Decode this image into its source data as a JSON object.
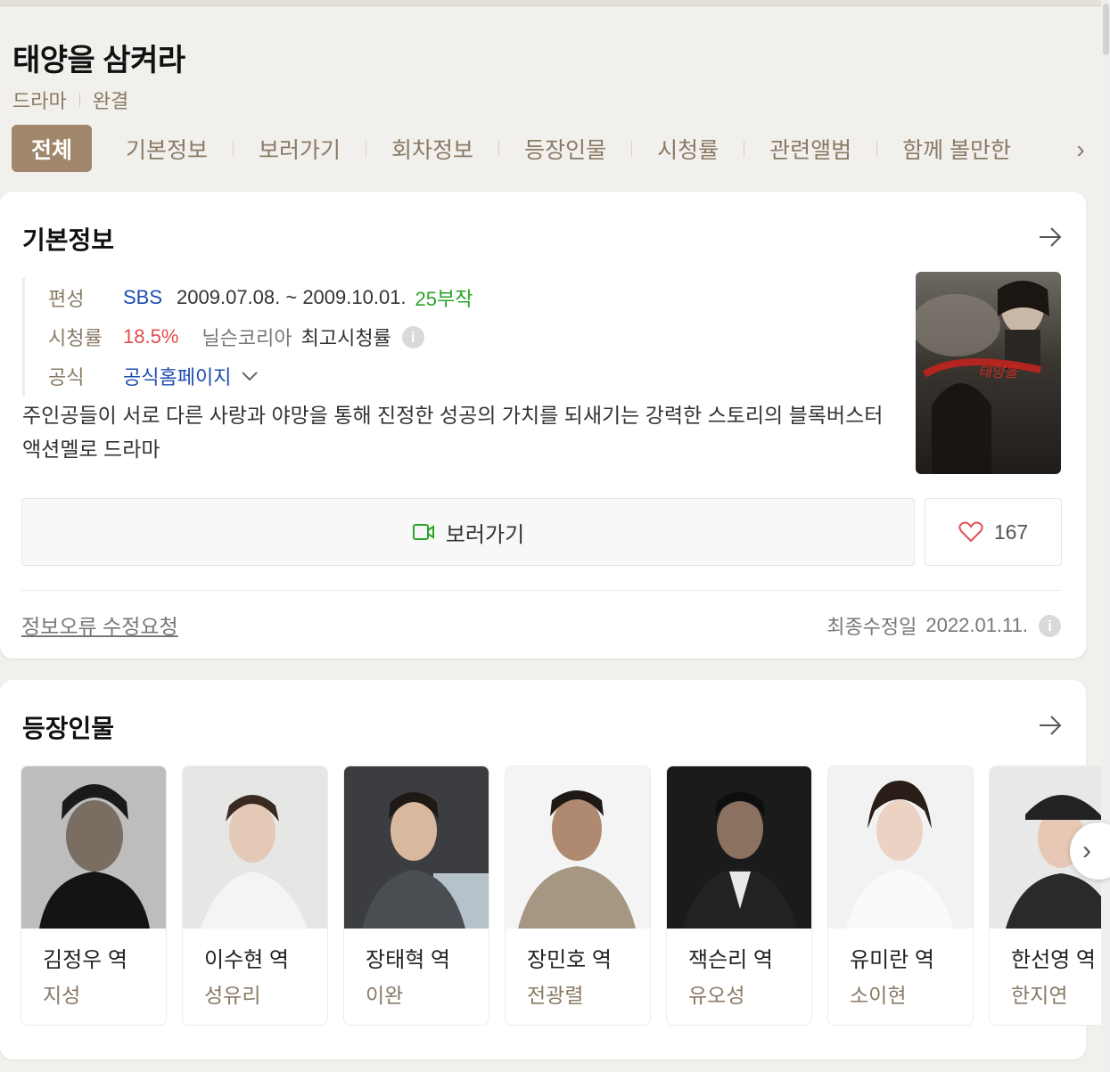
{
  "header": {
    "title": "태양을 삼켜라",
    "genre": "드라마",
    "status": "완결"
  },
  "tabs": [
    {
      "label": "전체",
      "active": true
    },
    {
      "label": "기본정보"
    },
    {
      "label": "보러가기"
    },
    {
      "label": "회차정보"
    },
    {
      "label": "등장인물"
    },
    {
      "label": "시청률"
    },
    {
      "label": "관련앨범"
    },
    {
      "label": "함께 볼만한"
    }
  ],
  "basic_info": {
    "section_title": "기본정보",
    "broadcast_label": "편성",
    "network": "SBS",
    "period": "2009.07.08. ~ 2009.10.01.",
    "episodes": "25부작",
    "rating_label": "시청률",
    "rating": "18.5%",
    "rating_source": "닐슨코리아",
    "rating_type": "최고시청률",
    "official_label": "공식",
    "official_link": "공식홈페이지",
    "description": "주인공들이 서로 다른 사랑과 야망을 통해 진정한 성공의 가치를 되새기는 강력한 스토리의 블록버스터 액션멜로 드라마",
    "watch_button": "보러가기",
    "like_count": "167",
    "report_link": "정보오류 수정요청",
    "modified_label": "최종수정일",
    "modified_date": "2022.01.11."
  },
  "cast": {
    "section_title": "등장인물",
    "members": [
      {
        "role": "김정우 역",
        "actor": "지성"
      },
      {
        "role": "이수현 역",
        "actor": "성유리"
      },
      {
        "role": "장태혁 역",
        "actor": "이완"
      },
      {
        "role": "장민호 역",
        "actor": "전광렬"
      },
      {
        "role": "잭슨리 역",
        "actor": "유오성"
      },
      {
        "role": "유미란 역",
        "actor": "소이현"
      },
      {
        "role": "한선영 역",
        "actor": "한지연"
      }
    ]
  },
  "colors": {
    "accent": "#a0866a",
    "network_blue": "#1e4db0",
    "rating_red": "#e04e4e",
    "episodes_green": "#2aa52a"
  }
}
